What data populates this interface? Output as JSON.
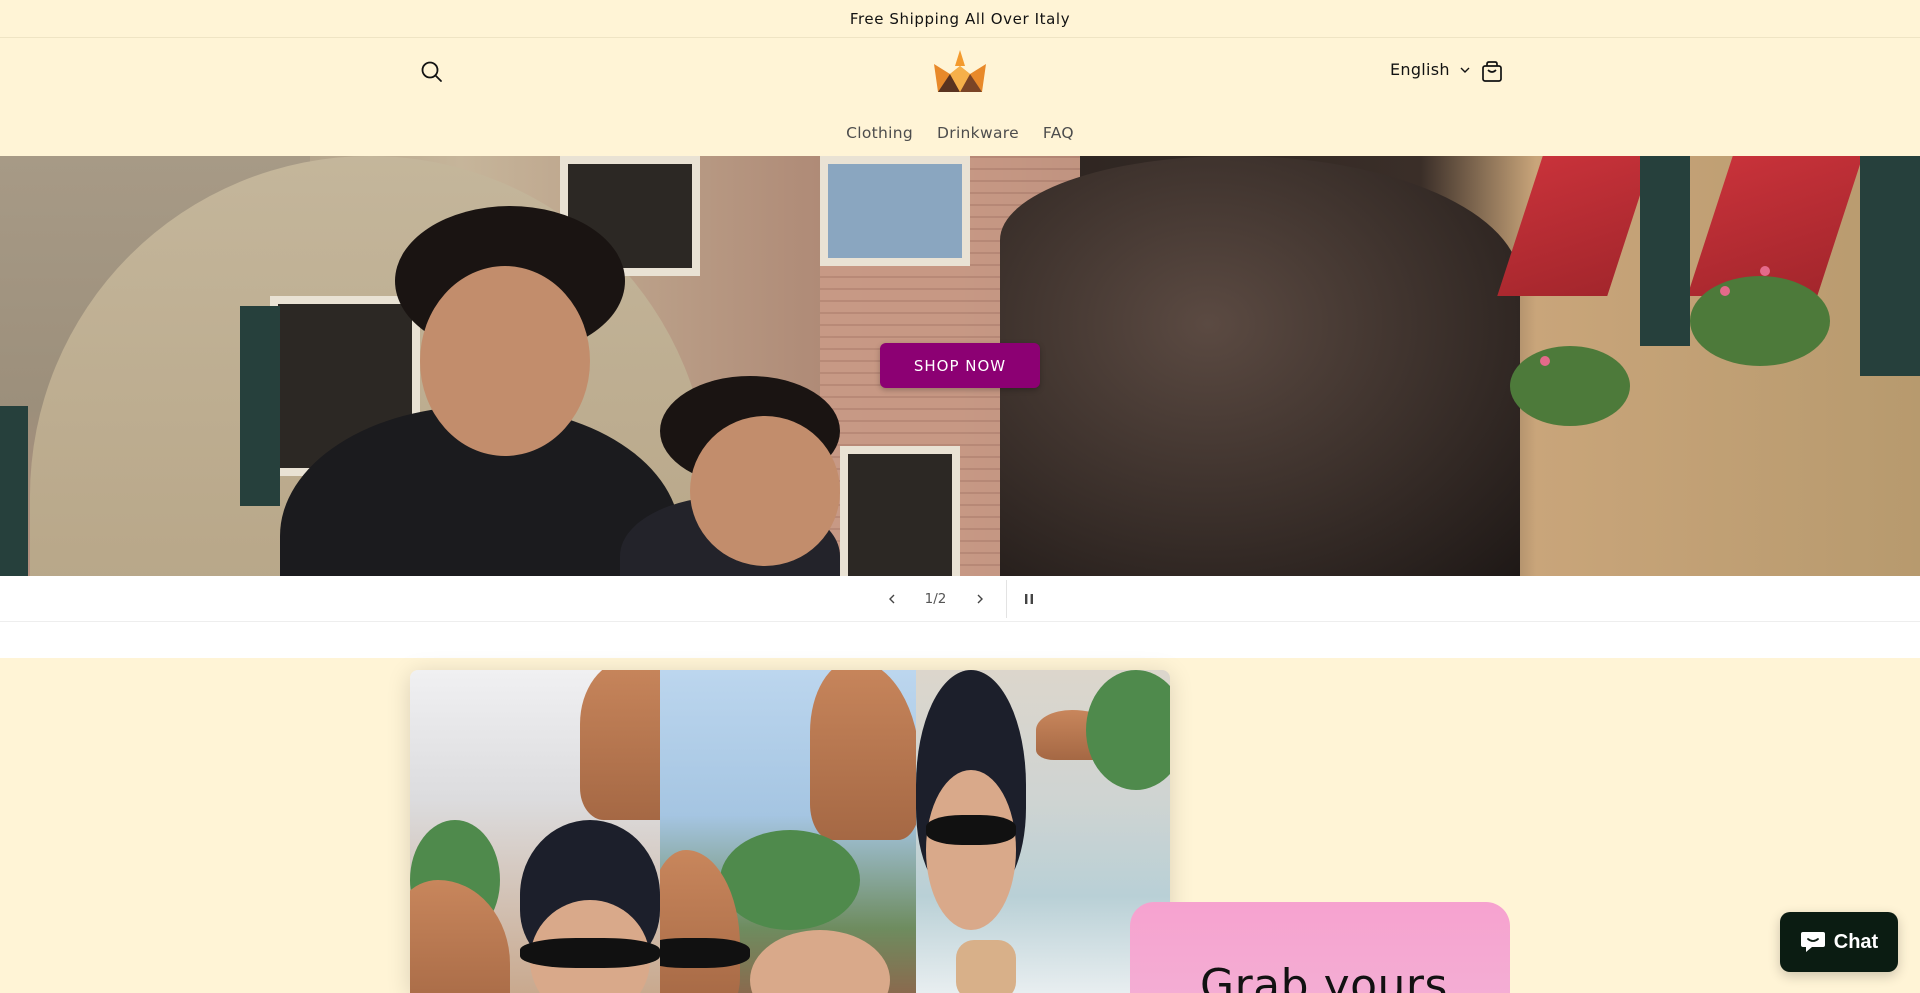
{
  "announcement": {
    "text": "Free Shipping All Over Italy"
  },
  "header": {
    "search_icon": "search-icon",
    "logo_icon": "crown-logo",
    "language": "English",
    "cart_icon": "cart-icon"
  },
  "nav": {
    "items": [
      {
        "label": "Clothing"
      },
      {
        "label": "Drinkware"
      },
      {
        "label": "FAQ"
      }
    ]
  },
  "hero": {
    "cta_label": "SHOP NOW",
    "cta_color": "#8c0073"
  },
  "slideshow": {
    "counter": "1/2",
    "prev_icon": "chevron-left-icon",
    "next_icon": "chevron-right-icon",
    "pause_icon": "pause-icon"
  },
  "promo": {
    "heading": "Grab yours"
  },
  "chat": {
    "label": "Chat",
    "icon": "chat-bubble-icon"
  },
  "colors": {
    "background": "#fff4d6",
    "promo_pink": "#f6a2cf",
    "chat_bg": "#0b1c12"
  }
}
